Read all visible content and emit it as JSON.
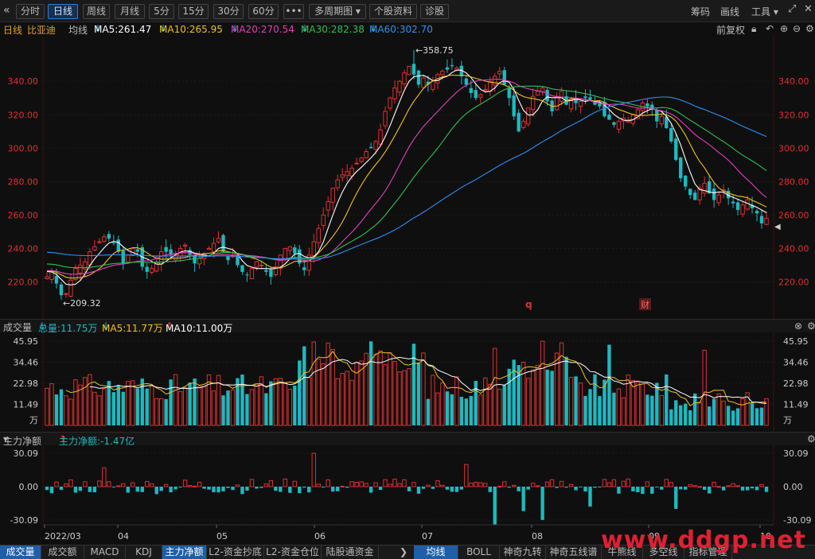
{
  "toolbar": {
    "back": "«",
    "periods": [
      "分时",
      "日线",
      "周线",
      "月线",
      "5分",
      "15分",
      "30分",
      "60分",
      "•••"
    ],
    "active_period": "日线",
    "multi_period": "多周期图",
    "stock_info": "个股资料",
    "diagnose": "诊股",
    "right": {
      "chips": "筹码",
      "draw": "画线",
      "tools": "工具"
    }
  },
  "info": {
    "period": "日线",
    "name": "比亚迪",
    "ma_label": "均线",
    "ma5": "MA5:261.47",
    "ma10": "MA10:265.95",
    "ma20": "MA20:270.54",
    "ma30": "MA30:282.38",
    "ma60": "MA60:302.70",
    "adjust": "前复权"
  },
  "volume_header": {
    "title": "成交量",
    "total": "总量:11.75万",
    "ma5": "MA5:11.77万",
    "ma10": "MA10:11.00万"
  },
  "flow_header": {
    "title": "主力净额",
    "value": "主力净额:-1.47亿"
  },
  "main_axis": [
    "340.00",
    "320.00",
    "300.00",
    "280.00",
    "260.00",
    "240.00",
    "220.00"
  ],
  "vol_axis": [
    "45.95",
    "34.46",
    "22.98",
    "11.49",
    "万"
  ],
  "flow_axis": [
    "30.09",
    "0.00",
    "-30.09"
  ],
  "dates": [
    "2022/03",
    "04",
    "05",
    "06",
    "07",
    "08",
    "09",
    "10"
  ],
  "annotations": {
    "high": "358.75",
    "low": "209.32",
    "q_marker": "q",
    "cai_marker": "财"
  },
  "colors": {
    "up": "#e03030",
    "down": "#1fb8c0",
    "ma5": "#ffffff",
    "ma10": "#f0c020",
    "ma20": "#e040c0",
    "ma30": "#30c050",
    "ma60": "#3090f0"
  },
  "bottom_tabs_left": [
    "成交量",
    "成交额",
    "MACD",
    "KDJ",
    "主力净额",
    "L2-资金抄底",
    "L2-资金仓位",
    "陆股通资金"
  ],
  "bottom_tabs_right": [
    "均线",
    "BOLL",
    "神奇九转",
    "神奇五线谱",
    "牛熊线",
    "多空线",
    "指标管理"
  ],
  "watermark": "www.ddgp.net",
  "chart_data": {
    "type": "candlestick",
    "title": "比亚迪 日线",
    "ylim": [
      205,
      362
    ],
    "closes": [
      223,
      226,
      219,
      212,
      213,
      221,
      228,
      230,
      232,
      238,
      241,
      244,
      247,
      246,
      243,
      238,
      231,
      236,
      240,
      238,
      229,
      226,
      228,
      232,
      238,
      238,
      236,
      237,
      240,
      242,
      236,
      231,
      234,
      237,
      240,
      243,
      246,
      238,
      233,
      236,
      230,
      226,
      224,
      228,
      232,
      230,
      226,
      223,
      229,
      236,
      240,
      241,
      237,
      231,
      227,
      236,
      244,
      252,
      260,
      268,
      276,
      281,
      284,
      286,
      288,
      291,
      294,
      298,
      300,
      304,
      311,
      322,
      330,
      336,
      340,
      345,
      349,
      344,
      338,
      342,
      338,
      340,
      344,
      346,
      347,
      349,
      348,
      343,
      338,
      333,
      330,
      332,
      335,
      340,
      343,
      346,
      338,
      330,
      319,
      310,
      316,
      324,
      331,
      334,
      336,
      328,
      322,
      331,
      334,
      326,
      329,
      327,
      328,
      330,
      329,
      326,
      325,
      319,
      317,
      314,
      316,
      318,
      317,
      320,
      323,
      327,
      325,
      323,
      316,
      319,
      312,
      304,
      293,
      282,
      277,
      272,
      269,
      276,
      279,
      273,
      269,
      272,
      275,
      270,
      267,
      263,
      266,
      269,
      264,
      261,
      255,
      258
    ]
  }
}
